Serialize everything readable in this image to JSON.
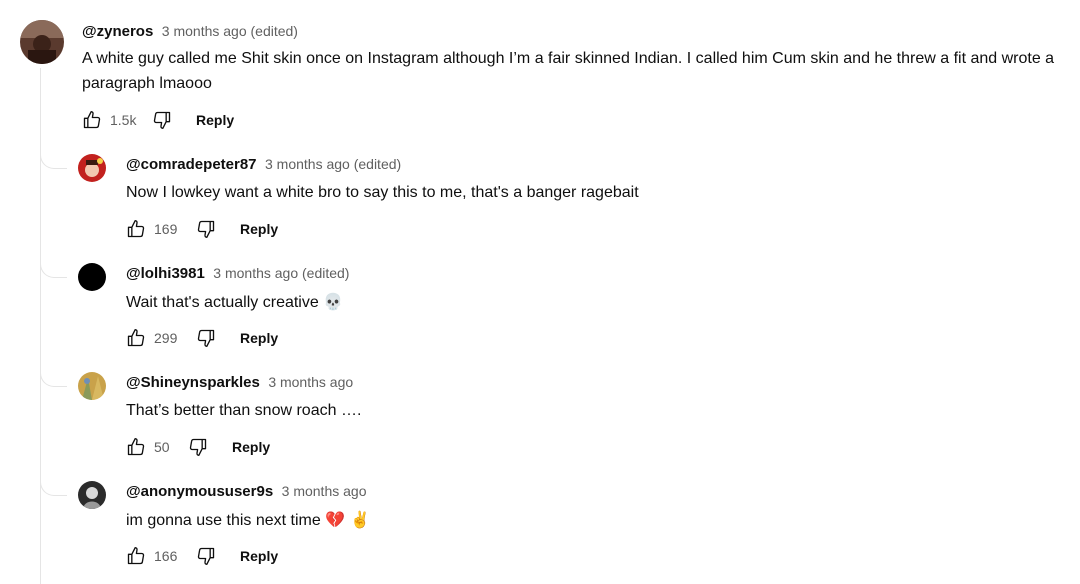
{
  "comments": [
    {
      "author": "@zyneros",
      "time": "3 months ago (edited)",
      "text": "A white guy called me Shit skin once on Instagram although I’m a fair skinned Indian. I called him Cum skin and he threw a fit and wrote a paragraph lmaooo",
      "likes": "1.5k",
      "reply_label": "Reply"
    }
  ],
  "replies": [
    {
      "author": "@comradepeter87",
      "time": "3 months ago (edited)",
      "text": "Now I lowkey want a white bro to say this to me, that's a banger ragebait",
      "likes": "169",
      "reply_label": "Reply"
    },
    {
      "author": "@lolhi3981",
      "time": "3 months ago (edited)",
      "text": "Wait that's actually creative",
      "emoji": "💀",
      "likes": "299",
      "reply_label": "Reply"
    },
    {
      "author": "@Shineynsparkles",
      "time": "3 months ago",
      "text": "That’s better than snow roach ….",
      "likes": "50",
      "reply_label": "Reply"
    },
    {
      "author": "@anonymoususer9s",
      "time": "3 months ago",
      "text": "im gonna use this next time",
      "emoji": "💔 ✌️",
      "likes": "166",
      "reply_label": "Reply"
    }
  ],
  "icons": {
    "like": "thumbs-up-icon",
    "dislike": "thumbs-down-icon"
  },
  "colors": {
    "text": "#0f0f0f",
    "meta": "#606060",
    "thread_line": "#e5e5e5"
  }
}
